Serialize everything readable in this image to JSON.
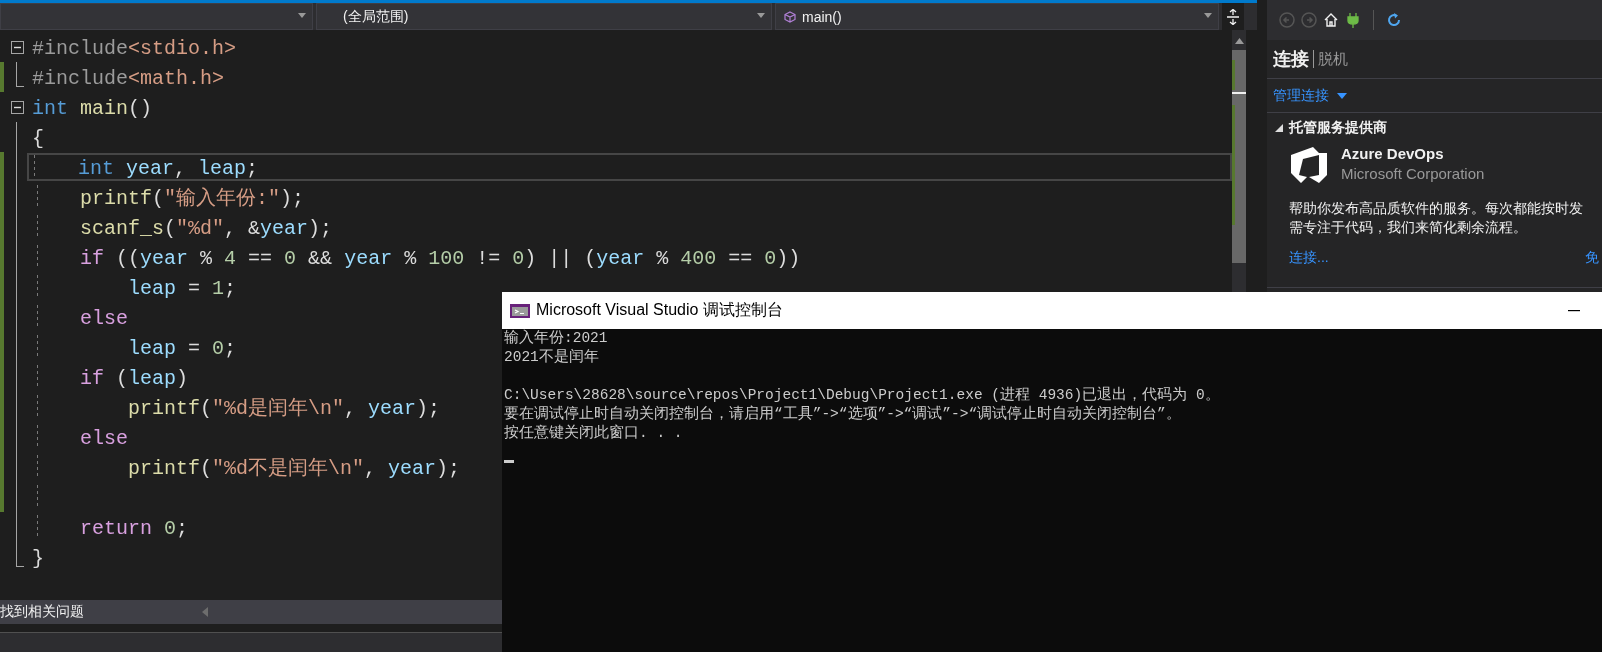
{
  "navigation_bar": {
    "dropdowns": [
      {
        "kind": "project"
      },
      {
        "kind": "scope",
        "text": "(全局范围)"
      },
      {
        "kind": "member",
        "text": "main()"
      }
    ]
  },
  "editor": {
    "lines": [
      {
        "kind": "block_start",
        "changed": false,
        "current": false,
        "tokens": [
          {
            "kind": "pre",
            "text": "#include"
          },
          {
            "kind": "inc",
            "text": "<stdio.h>"
          }
        ]
      },
      {
        "kind": "block_end",
        "changed": true,
        "current": false,
        "tokens": [
          {
            "kind": "pre",
            "text": "#include"
          },
          {
            "kind": "inc",
            "text": "<math.h>"
          }
        ]
      },
      {
        "kind": "block_start",
        "changed": false,
        "current": false,
        "tokens": [
          {
            "kind": "kw",
            "text": "int "
          },
          {
            "kind": "fn",
            "text": "main"
          },
          {
            "kind": "plain",
            "text": "()"
          }
        ]
      },
      {
        "kind": "block_body",
        "changed": false,
        "current": false,
        "tokens": [
          {
            "kind": "plain",
            "text": "{"
          }
        ]
      },
      {
        "kind": "block_body",
        "changed": true,
        "current": true,
        "tokens": [
          {
            "kind": "kw",
            "text": "    int "
          },
          {
            "kind": "var",
            "text": "year"
          },
          {
            "kind": "plain",
            "text": ", "
          },
          {
            "kind": "var",
            "text": "leap"
          },
          {
            "kind": "plain",
            "text": ";"
          }
        ]
      },
      {
        "kind": "block_body",
        "changed": true,
        "current": false,
        "tokens": [
          {
            "kind": "fn",
            "text": "    printf"
          },
          {
            "kind": "plain",
            "text": "("
          },
          {
            "kind": "str",
            "text": "\"输入年份:\""
          },
          {
            "kind": "plain",
            "text": ");"
          }
        ]
      },
      {
        "kind": "block_body",
        "changed": true,
        "current": false,
        "tokens": [
          {
            "kind": "fn",
            "text": "    scanf_s"
          },
          {
            "kind": "plain",
            "text": "("
          },
          {
            "kind": "str",
            "text": "\"%d\""
          },
          {
            "kind": "plain",
            "text": ", &"
          },
          {
            "kind": "var",
            "text": "year"
          },
          {
            "kind": "plain",
            "text": ");"
          }
        ]
      },
      {
        "kind": "block_body",
        "changed": true,
        "current": false,
        "tokens": [
          {
            "kind": "ctl",
            "text": "    if"
          },
          {
            "kind": "plain",
            "text": " (("
          },
          {
            "kind": "var",
            "text": "year"
          },
          {
            "kind": "plain",
            "text": " % "
          },
          {
            "kind": "num",
            "text": "4"
          },
          {
            "kind": "plain",
            "text": " == "
          },
          {
            "kind": "num",
            "text": "0"
          },
          {
            "kind": "plain",
            "text": " && "
          },
          {
            "kind": "var",
            "text": "year"
          },
          {
            "kind": "plain",
            "text": " % "
          },
          {
            "kind": "num",
            "text": "100"
          },
          {
            "kind": "plain",
            "text": " != "
          },
          {
            "kind": "num",
            "text": "0"
          },
          {
            "kind": "plain",
            "text": ") || ("
          },
          {
            "kind": "var",
            "text": "year"
          },
          {
            "kind": "plain",
            "text": " % "
          },
          {
            "kind": "num",
            "text": "400"
          },
          {
            "kind": "plain",
            "text": " == "
          },
          {
            "kind": "num",
            "text": "0"
          },
          {
            "kind": "plain",
            "text": "))"
          }
        ]
      },
      {
        "kind": "block_body",
        "changed": true,
        "current": false,
        "tokens": [
          {
            "kind": "var",
            "text": "        leap"
          },
          {
            "kind": "plain",
            "text": " = "
          },
          {
            "kind": "num",
            "text": "1"
          },
          {
            "kind": "plain",
            "text": ";"
          }
        ]
      },
      {
        "kind": "block_body",
        "changed": true,
        "current": false,
        "tokens": [
          {
            "kind": "ctl",
            "text": "    else"
          }
        ]
      },
      {
        "kind": "block_body",
        "changed": true,
        "current": false,
        "tokens": [
          {
            "kind": "var",
            "text": "        leap"
          },
          {
            "kind": "plain",
            "text": " = "
          },
          {
            "kind": "num",
            "text": "0"
          },
          {
            "kind": "plain",
            "text": ";"
          }
        ]
      },
      {
        "kind": "block_body",
        "changed": true,
        "current": false,
        "tokens": [
          {
            "kind": "ctl",
            "text": "    if"
          },
          {
            "kind": "plain",
            "text": " ("
          },
          {
            "kind": "var",
            "text": "leap"
          },
          {
            "kind": "plain",
            "text": ")"
          }
        ]
      },
      {
        "kind": "block_body",
        "changed": true,
        "current": false,
        "tokens": [
          {
            "kind": "fn",
            "text": "        printf"
          },
          {
            "kind": "plain",
            "text": "("
          },
          {
            "kind": "str",
            "text": "\"%d是闰年\\n\""
          },
          {
            "kind": "plain",
            "text": ", "
          },
          {
            "kind": "var",
            "text": "year"
          },
          {
            "kind": "plain",
            "text": ");"
          }
        ]
      },
      {
        "kind": "block_body",
        "changed": true,
        "current": false,
        "tokens": [
          {
            "kind": "ctl",
            "text": "    else"
          }
        ]
      },
      {
        "kind": "block_body",
        "changed": true,
        "current": false,
        "tokens": [
          {
            "kind": "fn",
            "text": "        printf"
          },
          {
            "kind": "plain",
            "text": "("
          },
          {
            "kind": "str",
            "text": "\"%d不是闰年\\n\""
          },
          {
            "kind": "plain",
            "text": ", "
          },
          {
            "kind": "var",
            "text": "year"
          },
          {
            "kind": "plain",
            "text": ");"
          }
        ]
      },
      {
        "kind": "block_body",
        "changed": true,
        "current": false
      },
      {
        "kind": "block_body",
        "changed": false,
        "current": false,
        "tokens": [
          {
            "kind": "ctl",
            "text": "    return "
          },
          {
            "kind": "num",
            "text": "0"
          },
          {
            "kind": "plain",
            "text": ";"
          }
        ]
      },
      {
        "kind": "block_end",
        "changed": false,
        "current": false,
        "tokens": [
          {
            "kind": "plain",
            "text": "}"
          }
        ]
      }
    ]
  },
  "status_strip": {
    "text": "找到相关问题"
  },
  "team_explorer": {
    "toolbar": [
      {
        "kind": "back",
        "disabled": true
      },
      {
        "kind": "forward",
        "disabled": true
      },
      {
        "kind": "home",
        "disabled": false
      },
      {
        "kind": "plug",
        "disabled": false
      },
      {
        "kind": "refresh",
        "disabled": false
      }
    ],
    "title": "连接",
    "subtitle": "脱机",
    "manage_link": "管理连接",
    "section": {
      "title": "托管服务提供商",
      "expanded": true,
      "provider": {
        "name": "Azure DevOps",
        "publisher": "Microsoft Corporation",
        "description_lines": [
          "帮助你发布高品质软件的服务。每次都能按时发",
          "需专注于代码，我们来简化剩余流程。"
        ],
        "links": [
          "连接...",
          "免"
        ]
      }
    }
  },
  "console_window": {
    "title": "Microsoft Visual Studio 调试控制台",
    "output_blocks": [
      [
        "输入年份:2021",
        "2021不是闰年"
      ],
      [
        "C:\\Users\\28628\\source\\repos\\Project1\\Debug\\Project1.exe (进程 4936)已退出，代码为 0。",
        "要在调试停止时自动关闭控制台，请启用“工具”->“选项”->“调试”->“调试停止时自动关闭控制台”。",
        "按任意键关闭此窗口. . ."
      ]
    ]
  }
}
